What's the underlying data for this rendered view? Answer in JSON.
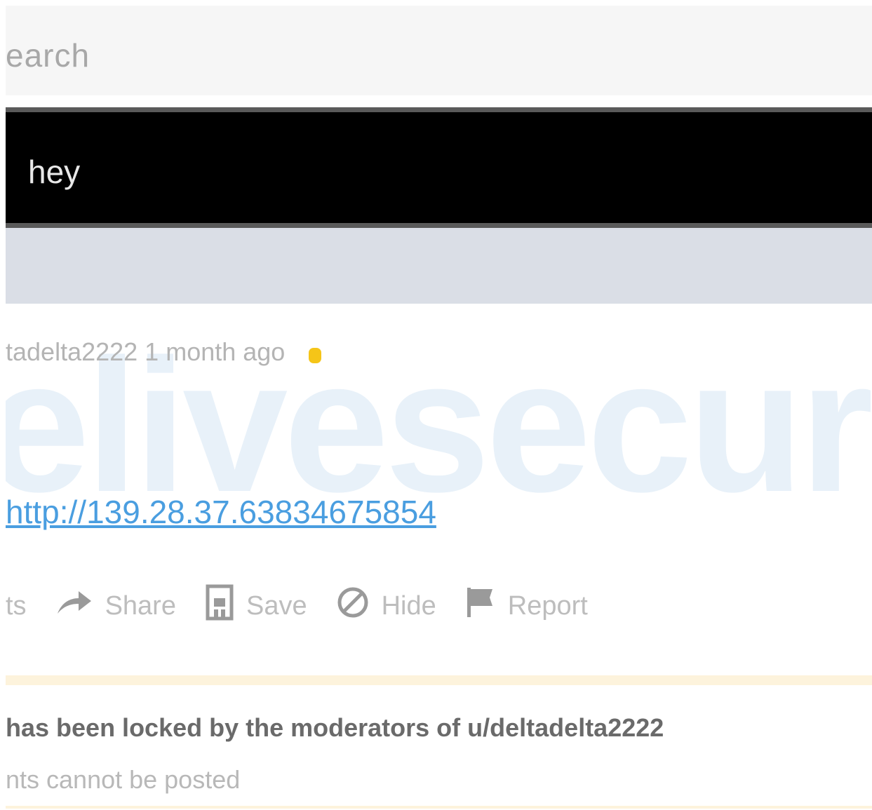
{
  "search": {
    "text": "earch"
  },
  "banner": {
    "title": "hey"
  },
  "post": {
    "meta": "tadelta2222 1 month ago",
    "watermark": "elivesecur",
    "link": "http://139.28.37.63834675854",
    "actions": {
      "comments_partial": "ts",
      "share": "Share",
      "save": "Save",
      "hide": "Hide",
      "report": "Report"
    }
  },
  "notice": {
    "title": "has been locked by the moderators of u/deltadelta2222",
    "subtitle": "nts cannot be posted"
  },
  "colors": {
    "link": "#4a9ee0",
    "lock": "#f5c518",
    "banner_bg": "#000000",
    "band_bg": "#dadee6",
    "notice_border": "#fdf3dc"
  }
}
